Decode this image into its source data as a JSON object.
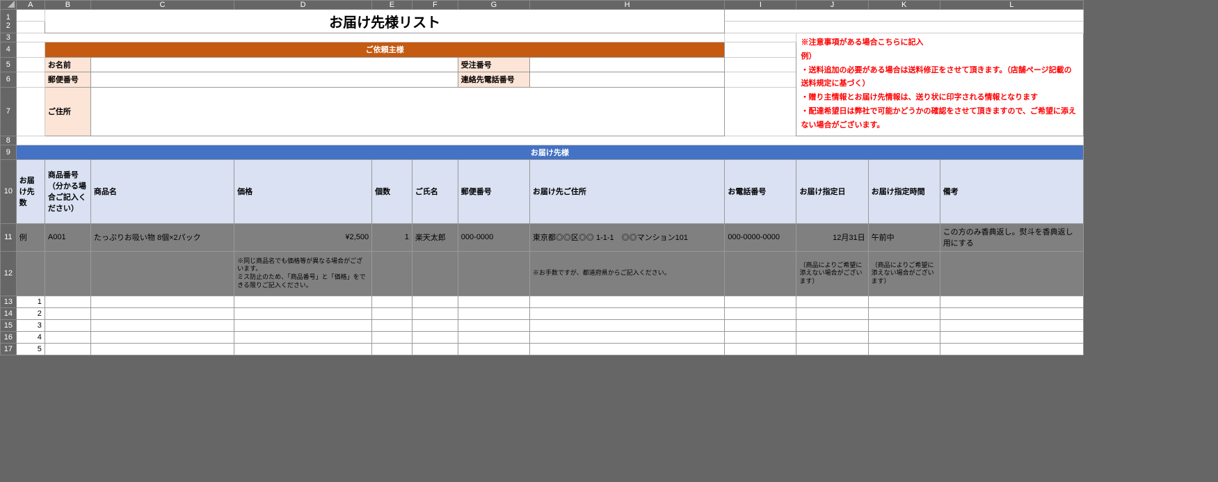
{
  "cols": [
    "A",
    "B",
    "C",
    "D",
    "E",
    "F",
    "G",
    "H",
    "I",
    "J",
    "K",
    "L"
  ],
  "rows": [
    "1",
    "2",
    "3",
    "4",
    "5",
    "6",
    "7",
    "8",
    "9",
    "10",
    "11",
    "12",
    "13",
    "14",
    "15",
    "16",
    "17"
  ],
  "title": "お届け先様リスト",
  "requester": {
    "header": "ご依頼主様",
    "name_label": "お名前",
    "order_label": "受注番号",
    "zip_label": "郵便番号",
    "phone_label": "連絡先電話番号",
    "addr_label": "ご住所"
  },
  "notice": {
    "line1": "※注意事項がある場合こちらに記入",
    "line2": "例）",
    "line3": "・送料追加の必要がある場合は送料修正をさせて頂きます。（店舗ページ記載の送料規定に基づく）",
    "line4": "・贈り主情報とお届け先情報は、送り状に印字される情報となります",
    "line5": "・配達希望日は弊社で可能かどうかの確認をさせて頂きますので、ご希望に添えない場合がございます。"
  },
  "recipient": {
    "header": "お届け先様",
    "cols": {
      "a": "お届け先数",
      "b": "商品番号（分かる場合ご記入ください）",
      "c": "商品名",
      "d": "価格",
      "e": "個数",
      "f": "ご氏名",
      "g": "郵便番号",
      "h": "お届け先ご住所",
      "i": "お電話番号",
      "j": "お届け指定日",
      "k": "お届け指定時間",
      "l": "備考"
    }
  },
  "example": {
    "a": "例",
    "b": "A001",
    "c": "たっぷりお吸い物 8個×2パック",
    "d": "¥2,500",
    "e": "1",
    "f": "楽天太郎",
    "g": "000-0000",
    "h": "東京都◎◎区◎◎ 1-1-1　◎◎マンション101",
    "i": "000-0000-0000",
    "j": "12月31日",
    "k": "午前中",
    "l": "この方のみ香典返し。熨斗を香典返し用にする"
  },
  "notes": {
    "d": "※同じ商品名でも価格等が異なる場合がございます。\nミス防止のため、「商品番号」と「価格」をできる限りご記入ください。",
    "h": "※お手数ですが、都道府県からご記入ください。",
    "j": "（商品によりご希望に添えない場合がございます）",
    "k": "（商品によりご希望に添えない場合がございます）"
  },
  "datarows": [
    "1",
    "2",
    "3",
    "4",
    "5"
  ]
}
